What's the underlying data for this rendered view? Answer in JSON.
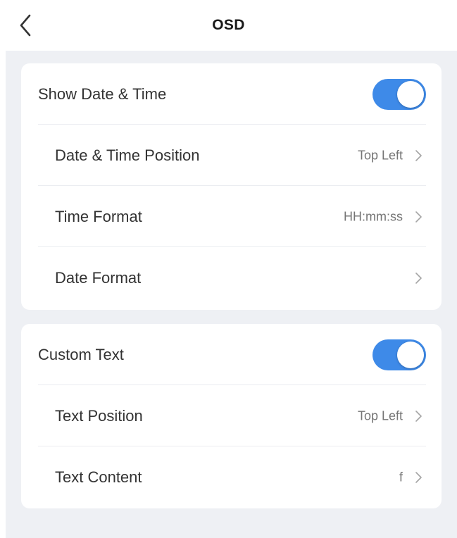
{
  "header": {
    "title": "OSD",
    "back_icon": "chevron-left-icon"
  },
  "date_time_section": {
    "show_label": "Show Date & Time",
    "show_enabled": true,
    "position_label": "Date & Time Position",
    "position_value": "Top Left",
    "time_format_label": "Time Format",
    "time_format_value": "HH:mm:ss",
    "date_format_label": "Date Format",
    "date_format_value": ""
  },
  "custom_text_section": {
    "custom_label": "Custom Text",
    "custom_enabled": true,
    "position_label": "Text Position",
    "position_value": "Top Left",
    "content_label": "Text Content",
    "content_value": "f"
  },
  "colors": {
    "accent": "#3e8ae8",
    "background": "#eef0f4",
    "card": "#ffffff",
    "primary_text": "#333333",
    "secondary_text": "#757575"
  }
}
